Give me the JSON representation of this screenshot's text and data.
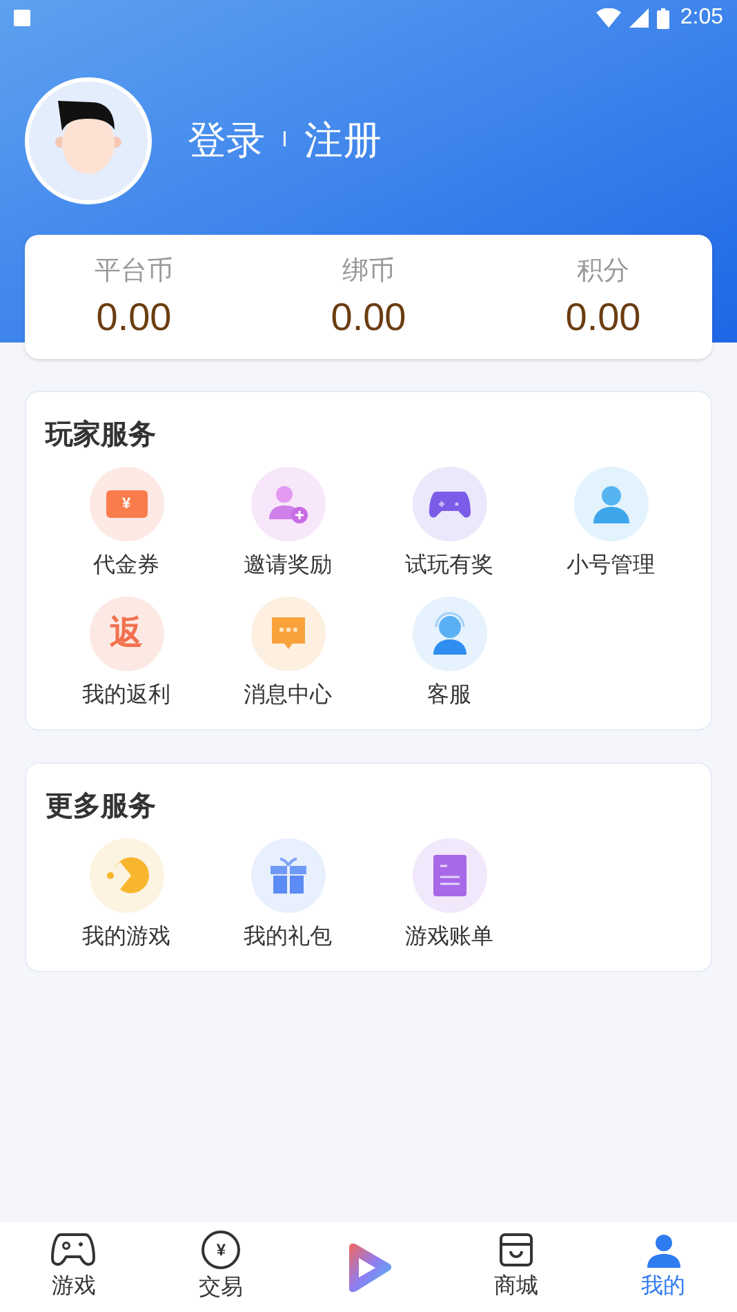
{
  "status_bar": {
    "time": "2:05"
  },
  "header": {
    "login": "登录",
    "separator": "I",
    "register": "注册"
  },
  "balances": [
    {
      "label": "平台币",
      "value": "0.00"
    },
    {
      "label": "绑币",
      "value": "0.00"
    },
    {
      "label": "积分",
      "value": "0.00"
    }
  ],
  "sections": [
    {
      "title": "玩家服务",
      "items": [
        {
          "label": "代金券",
          "kind": "voucher",
          "glyph": "¥",
          "color": "#fde9e4"
        },
        {
          "label": "邀请奖励",
          "kind": "invite",
          "color": "#f8e6fb"
        },
        {
          "label": "试玩有奖",
          "kind": "gamepad",
          "color": "#ebe8fb"
        },
        {
          "label": "小号管理",
          "kind": "user",
          "color": "#e3f3fd"
        },
        {
          "label": "我的返利",
          "kind": "rebate",
          "glyph": "返",
          "color": "#fde9e4"
        },
        {
          "label": "消息中心",
          "kind": "message",
          "color": "#fdf0e1"
        },
        {
          "label": "客服",
          "kind": "support",
          "color": "#e6f2fd"
        }
      ]
    },
    {
      "title": "更多服务",
      "items": [
        {
          "label": "我的游戏",
          "kind": "pacman",
          "color": "#fdf3e1"
        },
        {
          "label": "我的礼包",
          "kind": "gift",
          "color": "#e8effd"
        },
        {
          "label": "游戏账单",
          "kind": "bill",
          "color": "#f1e8fb"
        }
      ]
    }
  ],
  "tab_bar": [
    {
      "label": "游戏",
      "kind": "gamepad",
      "selected": false
    },
    {
      "label": "交易",
      "kind": "trade",
      "glyph": "¥",
      "selected": false
    },
    {
      "kind": "play"
    },
    {
      "label": "商城",
      "kind": "shop",
      "selected": false
    },
    {
      "label": "我的",
      "kind": "me",
      "selected": true
    }
  ]
}
